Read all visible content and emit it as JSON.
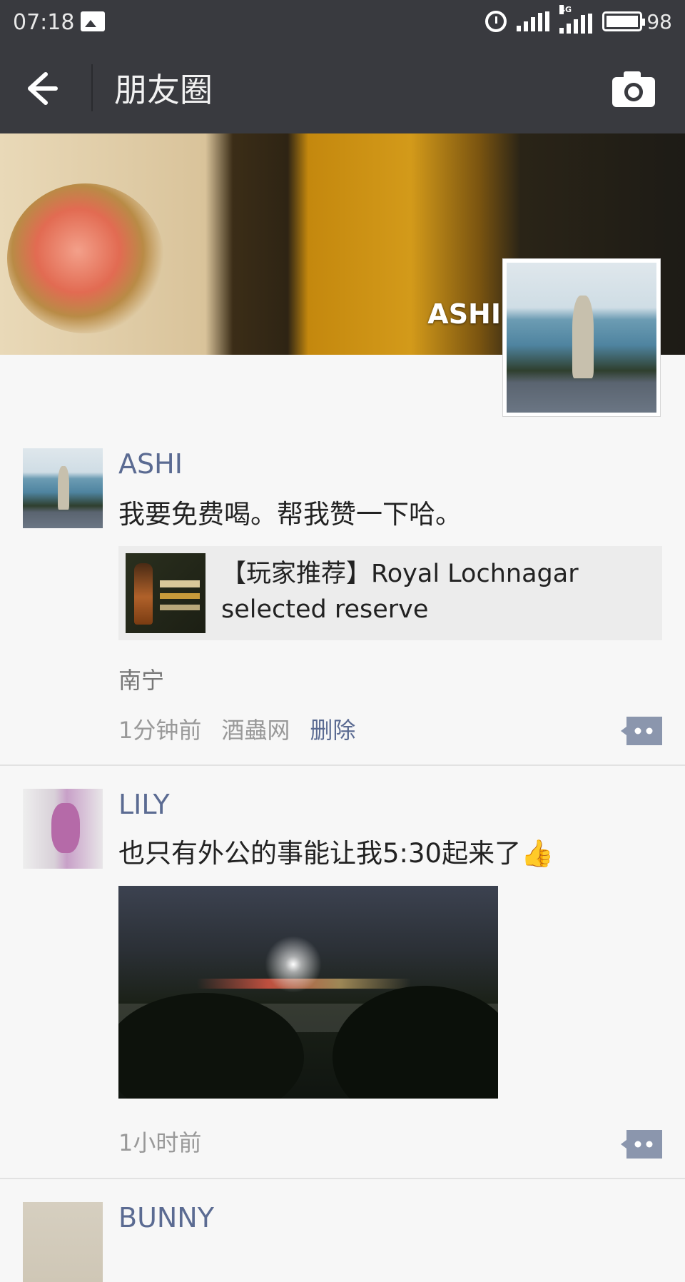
{
  "status_bar": {
    "time": "07:18",
    "network": "4G",
    "battery": "98"
  },
  "header": {
    "title": "朋友圈"
  },
  "cover": {
    "name": "ASHI"
  },
  "posts": [
    {
      "nickname": "ASHI",
      "text": "我要免费喝。帮我赞一下哈。",
      "link": {
        "title": "【玩家推荐】Royal Lochnagar selected reserve"
      },
      "location": "南宁",
      "time": "1分钟前",
      "source": "酒蟲网",
      "delete_label": "删除"
    },
    {
      "nickname": "LILY",
      "text": "也只有外公的事能让我5:30起来了👍",
      "time": "1小时前"
    },
    {
      "nickname": "BUNNY"
    }
  ],
  "colors": {
    "bar": "#393a3f",
    "nickname": "#5b6b92",
    "background": "#f7f7f7"
  }
}
